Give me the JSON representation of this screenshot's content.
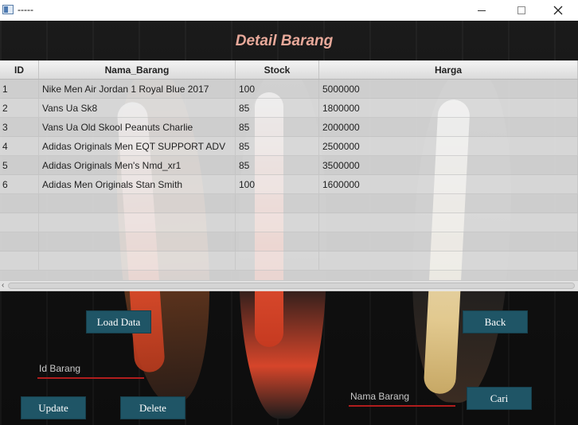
{
  "window": {
    "title": "-----"
  },
  "heading": "Detail Barang",
  "table": {
    "columns": [
      "ID",
      "Nama_Barang",
      "Stock",
      "Harga"
    ],
    "rows": [
      [
        "1",
        "Nike Men Air Jordan 1 Royal Blue 2017",
        "100",
        "5000000"
      ],
      [
        "2",
        "Vans Ua Sk8",
        "85",
        "1800000"
      ],
      [
        "3",
        "Vans Ua Old Skool Peanuts Charlie",
        "85",
        "2000000"
      ],
      [
        "4",
        "Adidas Originals Men EQT SUPPORT ADV",
        "85",
        "2500000"
      ],
      [
        "5",
        "Adidas Originals Men's Nmd_xr1",
        "85",
        "3500000"
      ],
      [
        "6",
        "Adidas Men Originals Stan Smith",
        "100",
        "1600000"
      ]
    ]
  },
  "buttons": {
    "load": "Load Data",
    "back": "Back",
    "update": "Update",
    "delete": "Delete",
    "cari": "Cari"
  },
  "fields": {
    "id_barang": "Id Barang",
    "nama_barang": "Nama Barang"
  },
  "icons": {
    "app": "app-window-icon",
    "minimize": "minimize-icon",
    "maximize": "maximize-icon",
    "close": "close-icon",
    "scroll_left": "scroll-left-arrow-icon"
  },
  "colors": {
    "button_bg": "#1f5566",
    "heading": "#e8a99a",
    "field_underline": "#b01d1d"
  }
}
